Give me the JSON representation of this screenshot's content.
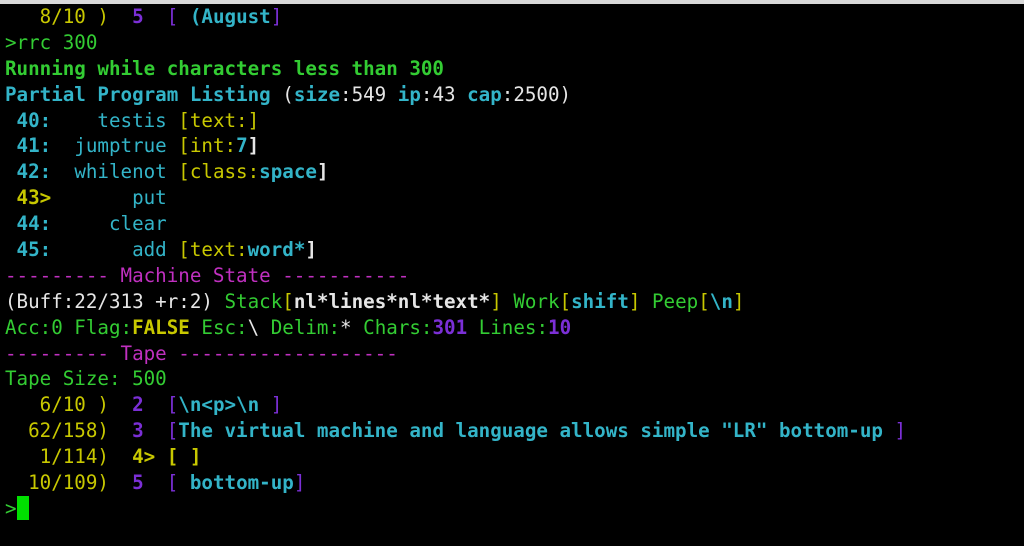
{
  "terminal": {
    "lines": [
      [
        {
          "t": "   8/10 )  ",
          "c": "y"
        },
        {
          "t": "5",
          "c": "p",
          "b": true
        },
        {
          "t": "  [ ",
          "c": "p"
        },
        {
          "t": "(August",
          "c": "c",
          "b": true
        },
        {
          "t": "]",
          "c": "p"
        }
      ],
      [
        {
          "t": ">rrc 300",
          "c": "g"
        }
      ],
      [
        {
          "t": "Running while characters less than 300",
          "c": "g",
          "b": true
        }
      ],
      [
        {
          "t": "Partial Program Listing",
          "c": "c",
          "b": true
        },
        {
          "t": " (",
          "c": "w"
        },
        {
          "t": "size",
          "c": "c",
          "b": true
        },
        {
          "t": ":549 ",
          "c": "w"
        },
        {
          "t": "ip",
          "c": "c",
          "b": true
        },
        {
          "t": ":43 ",
          "c": "w"
        },
        {
          "t": "cap",
          "c": "c",
          "b": true
        },
        {
          "t": ":2500)",
          "c": "w"
        }
      ],
      [
        {
          "t": " 40:",
          "c": "c",
          "b": true
        },
        {
          "t": "    testis ",
          "c": "c"
        },
        {
          "t": "[text:]",
          "c": "y"
        }
      ],
      [
        {
          "t": " 41:",
          "c": "c",
          "b": true
        },
        {
          "t": "  jumptrue ",
          "c": "c"
        },
        {
          "t": "[int:",
          "c": "y"
        },
        {
          "t": "7",
          "c": "c",
          "b": true
        },
        {
          "t": "]",
          "c": "w",
          "b": true
        }
      ],
      [
        {
          "t": " 42:",
          "c": "c",
          "b": true
        },
        {
          "t": "  whilenot ",
          "c": "c"
        },
        {
          "t": "[class:",
          "c": "y"
        },
        {
          "t": "space",
          "c": "c",
          "b": true
        },
        {
          "t": "]",
          "c": "w",
          "b": true
        }
      ],
      [
        {
          "t": " 43>",
          "c": "y",
          "b": true
        },
        {
          "t": "       put",
          "c": "c"
        }
      ],
      [
        {
          "t": " 44:",
          "c": "c",
          "b": true
        },
        {
          "t": "     clear",
          "c": "c"
        }
      ],
      [
        {
          "t": " 45:",
          "c": "c",
          "b": true
        },
        {
          "t": "       add ",
          "c": "c"
        },
        {
          "t": "[text:",
          "c": "y"
        },
        {
          "t": "word*",
          "c": "c",
          "b": true
        },
        {
          "t": "]",
          "c": "w",
          "b": true
        }
      ],
      [
        {
          "t": "--------- Machine State -----------",
          "c": "m"
        }
      ],
      [
        {
          "t": "(Buff:22/313 +r:2) ",
          "c": "w"
        },
        {
          "t": "Stack",
          "c": "g"
        },
        {
          "t": "[",
          "c": "y"
        },
        {
          "t": "nl*lines*nl*text*",
          "c": "w",
          "b": true
        },
        {
          "t": "] ",
          "c": "y"
        },
        {
          "t": "Work",
          "c": "g"
        },
        {
          "t": "[",
          "c": "y"
        },
        {
          "t": "shift",
          "c": "c",
          "b": true
        },
        {
          "t": "] ",
          "c": "y"
        },
        {
          "t": "Peep",
          "c": "g"
        },
        {
          "t": "[",
          "c": "y"
        },
        {
          "t": "\\n",
          "c": "c",
          "b": true
        },
        {
          "t": "]",
          "c": "y"
        }
      ],
      [
        {
          "t": "Acc:0 Flag:",
          "c": "g"
        },
        {
          "t": "FALSE",
          "c": "y",
          "b": true
        },
        {
          "t": " Esc:",
          "c": "g"
        },
        {
          "t": "\\",
          "c": "w"
        },
        {
          "t": " Delim:",
          "c": "g"
        },
        {
          "t": "*",
          "c": "w"
        },
        {
          "t": " Chars:",
          "c": "g"
        },
        {
          "t": "301",
          "c": "p",
          "b": true
        },
        {
          "t": " Lines:",
          "c": "g"
        },
        {
          "t": "10",
          "c": "p",
          "b": true
        }
      ],
      [
        {
          "t": "--------- Tape -------------------",
          "c": "m"
        }
      ],
      [
        {
          "t": "Tape Size: 500",
          "c": "g"
        }
      ],
      [
        {
          "t": "   6/10 )  ",
          "c": "y"
        },
        {
          "t": "2",
          "c": "p",
          "b": true
        },
        {
          "t": "  [",
          "c": "p"
        },
        {
          "t": "\\n<p>\\n",
          "c": "c",
          "b": true
        },
        {
          "t": " ]",
          "c": "p"
        }
      ],
      [
        {
          "t": "  62/158)  ",
          "c": "y"
        },
        {
          "t": "3",
          "c": "p",
          "b": true
        },
        {
          "t": "  [",
          "c": "p"
        },
        {
          "t": "The virtual machine and language allows simple \"LR\" bottom-up",
          "c": "c",
          "b": true
        },
        {
          "t": " ]",
          "c": "p"
        }
      ],
      [
        {
          "t": "   1/114)  ",
          "c": "y"
        },
        {
          "t": "4>",
          "c": "y",
          "b": true
        },
        {
          "t": " [ ]",
          "c": "y",
          "b": true
        }
      ],
      [
        {
          "t": "  10/109)  ",
          "c": "y"
        },
        {
          "t": "5",
          "c": "p",
          "b": true
        },
        {
          "t": "  [ ",
          "c": "p"
        },
        {
          "t": "bottom-up",
          "c": "c",
          "b": true
        },
        {
          "t": "]",
          "c": "p"
        }
      ],
      [
        {
          "t": ">",
          "c": "g"
        }
      ]
    ]
  }
}
